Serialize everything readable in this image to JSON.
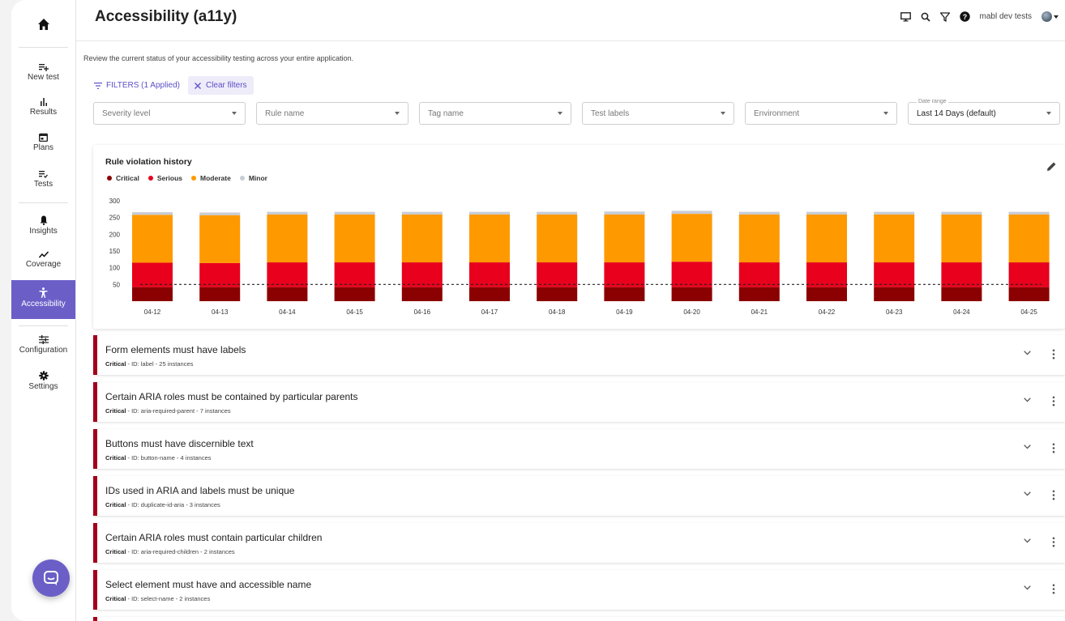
{
  "app": {
    "title": "Accessibility (a11y)",
    "user": "mabl dev tests",
    "accent": "#6b5fc7"
  },
  "sidebar": {
    "items": [
      {
        "label": "New test",
        "icon": "new-test-icon"
      },
      {
        "label": "Results",
        "icon": "results-bar-icon"
      },
      {
        "label": "Plans",
        "icon": "calendar-icon"
      },
      {
        "label": "Tests",
        "icon": "tests-list-icon"
      },
      {
        "label": "Insights",
        "icon": "bell-icon"
      },
      {
        "label": "Coverage",
        "icon": "trend-icon"
      },
      {
        "label": "Accessibility",
        "icon": "accessibility-icon"
      },
      {
        "label": "Configuration",
        "icon": "sliders-icon"
      },
      {
        "label": "Settings",
        "icon": "gear-icon"
      }
    ]
  },
  "main": {
    "subtitle": "Review the current status of your accessibility testing across your entire application.",
    "filters_label": "FILTERS (1 Applied)",
    "clear_filters": "Clear filters",
    "selects": [
      {
        "value": "Severity level"
      },
      {
        "value": "Rule name"
      },
      {
        "value": "Tag name"
      },
      {
        "value": "Test labels"
      },
      {
        "value": "Environment"
      },
      {
        "label": "Date range",
        "value": "Last 14 Days (default)"
      }
    ]
  },
  "chart_data": {
    "type": "bar",
    "stacked": true,
    "title": "Rule violation history",
    "categories": [
      "04-12",
      "04-13",
      "04-14",
      "04-15",
      "04-16",
      "04-17",
      "04-18",
      "04-19",
      "04-20",
      "04-21",
      "04-22",
      "04-23",
      "04-24",
      "04-25"
    ],
    "series": [
      {
        "name": "Critical",
        "color": "#8b0000",
        "values": [
          42,
          42,
          42,
          42,
          42,
          42,
          42,
          42,
          42,
          42,
          42,
          42,
          42,
          42
        ]
      },
      {
        "name": "Serious",
        "color": "#e8001c",
        "values": [
          73,
          72,
          74,
          74,
          74,
          74,
          74,
          74,
          76,
          74,
          74,
          74,
          74,
          74
        ]
      },
      {
        "name": "Moderate",
        "color": "#ff9900",
        "values": [
          143,
          143,
          143,
          143,
          143,
          143,
          143,
          143,
          143,
          143,
          143,
          143,
          143,
          143
        ]
      },
      {
        "name": "Minor",
        "color": "#c8ccd4",
        "values": [
          8,
          8,
          8,
          8,
          8,
          8,
          8,
          9,
          9,
          8,
          8,
          8,
          8,
          8
        ]
      }
    ],
    "ylim": [
      0,
      300
    ],
    "yticks": [
      50,
      100,
      150,
      200,
      250,
      300
    ],
    "threshold": 50,
    "grid": false,
    "legend": "top-left"
  },
  "rules": [
    {
      "title": "Form elements must have labels",
      "severity": "Critical",
      "meta": " - ID: label - 25 instances"
    },
    {
      "title": "Certain ARIA roles must be contained by particular parents",
      "severity": "Critical",
      "meta": " - ID: aria-required-parent - 7 instances"
    },
    {
      "title": "Buttons must have discernible text",
      "severity": "Critical",
      "meta": " - ID: button-name - 4 instances"
    },
    {
      "title": "IDs used in ARIA and labels must be unique",
      "severity": "Critical",
      "meta": " - ID: duplicate-id-aria - 3 instances"
    },
    {
      "title": "Certain ARIA roles must contain particular children",
      "severity": "Critical",
      "meta": " - ID: aria-required-children - 2 instances"
    },
    {
      "title": "Select element must have and accessible name",
      "severity": "Critical",
      "meta": " - ID: select-name - 2 instances"
    }
  ]
}
